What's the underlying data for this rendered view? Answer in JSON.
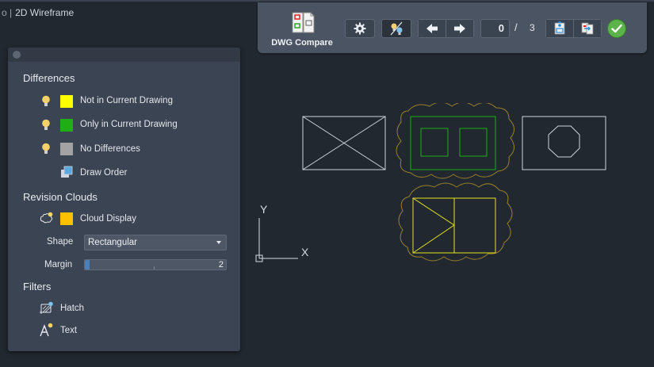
{
  "viewport": {
    "label": "2D Wireframe"
  },
  "toolbar": {
    "app_label": "DWG Compare",
    "page_current": "0",
    "page_separator": "/",
    "page_total": "3"
  },
  "panel": {
    "differences_title": "Differences",
    "differences": [
      {
        "label": "Not in Current Drawing",
        "color": "#ffff00"
      },
      {
        "label": "Only in Current Drawing",
        "color": "#1fae16"
      },
      {
        "label": "No Differences",
        "color": "#a3a3a3"
      }
    ],
    "draw_order_label": "Draw Order",
    "revision_clouds_title": "Revision Clouds",
    "cloud_display": {
      "label": "Cloud Display",
      "color": "#ffc000"
    },
    "shape": {
      "label": "Shape",
      "value": "Rectangular"
    },
    "margin": {
      "label": "Margin",
      "value": "2",
      "fraction": 0.02
    },
    "filters_title": "Filters",
    "filters": [
      {
        "label": "Hatch",
        "icon": "hatch-icon"
      },
      {
        "label": "Text",
        "icon": "text-icon"
      }
    ]
  },
  "ucs": {
    "x_label": "X",
    "y_label": "Y"
  },
  "colors": {
    "background": "#212830",
    "panel": "#3b4452",
    "toolbar": "#4a5462",
    "accent": "#4b7fb8",
    "cloud": "#9a7f2a",
    "only_current": "#1fae16",
    "not_current": "#ffff00"
  }
}
